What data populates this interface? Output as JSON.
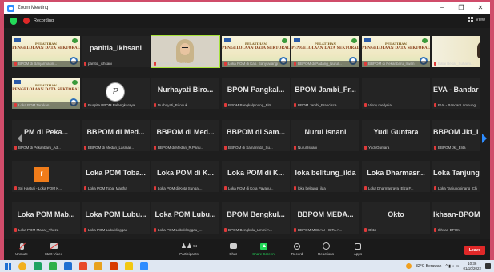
{
  "window": {
    "title": "Zoom Meeting",
    "controls": [
      "−",
      "❐",
      "✕"
    ]
  },
  "topbar": {
    "recording_label": "Recording",
    "view_label": "View"
  },
  "banner": {
    "line1": "PELATIHAN",
    "line2": "PENGELOLAAN DATA SEKTORAL"
  },
  "tiles": [
    {
      "type": "banner",
      "name": "BPOM di Banjarmasin..."
    },
    {
      "type": "text",
      "big": "panitia_ikhsani",
      "name": "panitia_ikhsani"
    },
    {
      "type": "person",
      "name": "BBPOM di Jakarta_ayuandini..."
    },
    {
      "type": "banner",
      "name": "Loka POM di Kab. Banyuwangi"
    },
    {
      "type": "banner",
      "name": "BBPOM di Padang_Nurul..."
    },
    {
      "type": "banner",
      "name": "BBPOM di Pekanbaru_Irwan"
    },
    {
      "type": "person2",
      "name": "Balai Besar_Suharni..."
    },
    {
      "type": "banner",
      "name": "Loka POM Tarakan..."
    },
    {
      "type": "avatar-p",
      "avatar": "P",
      "name": "Puspita BPOM Palangkaraya..."
    },
    {
      "type": "text",
      "big": "Nurhayati Biro...",
      "name": "Nurhayati_Biroduk..."
    },
    {
      "type": "text",
      "big": "BPOM Pangkal...",
      "name": "BPOM Pangkalpinang_Fitri..."
    },
    {
      "type": "text",
      "big": "BPOM Jambi_Fr...",
      "name": "BPOM Jambi_Francisca"
    },
    {
      "type": "text",
      "big": "",
      "name": "Vinny meilynia"
    },
    {
      "type": "text",
      "big": "EVA - Bandar La...",
      "name": "EVA - Bandar Lampung"
    },
    {
      "type": "text",
      "big": "PM di Peka...",
      "name": "BPOM di Pekanbaru_Ad..."
    },
    {
      "type": "text",
      "big": "BBPOM di Med...",
      "name": "BBPOM di Medan_Lasmar..."
    },
    {
      "type": "text",
      "big": "BBPOM di Med...",
      "name": "BBPOM di Medan_R.Panu..."
    },
    {
      "type": "text",
      "big": "BBPOM di Sam...",
      "name": "BBPOM di Samarinda_Su..."
    },
    {
      "type": "text",
      "big": "Nurul Isnani",
      "name": "Nurul Isnani"
    },
    {
      "type": "text",
      "big": "Yudi Guntara",
      "name": "Yudi Guntara"
    },
    {
      "type": "text",
      "big": "BBPOM Jkt_I",
      "name": "BBPOM Jkt_Elita"
    },
    {
      "type": "avatar-r",
      "avatar": "r",
      "name": "Sri Hastuti - Loka POM K..."
    },
    {
      "type": "text",
      "big": "Loka POM Toba...",
      "name": "Loka POM Toba_Martha"
    },
    {
      "type": "text",
      "big": "Loka POM di K...",
      "name": "Loka POM di Kota Sungai..."
    },
    {
      "type": "text",
      "big": "Loka POM di K...",
      "name": "Loka POM di Kota Payaku..."
    },
    {
      "type": "text",
      "big": "loka belitung_ilda",
      "name": "loka belitung_ilda"
    },
    {
      "type": "text",
      "big": "Loka Dharmasr...",
      "name": "Loka Dharmasraya_Elza F..."
    },
    {
      "type": "text",
      "big": "Loka Tanjungpi...",
      "name": "Loka Tanjungpinang_Chi..."
    },
    {
      "type": "text",
      "big": "Loka POM Mab...",
      "name": "Loka POM Mabar_Theza"
    },
    {
      "type": "text",
      "big": "Loka POM Lubu...",
      "name": "Loka POM Lubuklinggau"
    },
    {
      "type": "text",
      "big": "Loka POM Lubu...",
      "name": "Loka POM Lubuklinggau_..."
    },
    {
      "type": "text",
      "big": "BPOM Bengkul...",
      "name": "BPOM Bengkulu_Ummi A..."
    },
    {
      "type": "text",
      "big": "BBPOM MEDA...",
      "name": "BBPOM MEDAN - GITA A..."
    },
    {
      "type": "text",
      "big": "Okto",
      "name": "Okto"
    },
    {
      "type": "text",
      "big": "Ikhsan-BPOM",
      "name": "Ikhsan-BPOM"
    }
  ],
  "toolbar": {
    "unmute": "Unmute",
    "start_video": "Start Video",
    "participants": "Participants",
    "participants_count": "94",
    "chat": "Chat",
    "share_screen": "Share Screen",
    "record": "Record",
    "reactions": "Reactions",
    "apps": "Apps",
    "leave": "Leave"
  },
  "taskbar": {
    "weather": "32°C Berawan",
    "time": "10.36",
    "date": "01/10/2022",
    "colors": [
      "#f2b01e",
      "#1ea362",
      "#2fb04a",
      "#1f6fd1",
      "#e84a2a",
      "#e8a21e",
      "#d83b01",
      "#f2c811",
      "#2d8cff"
    ]
  }
}
